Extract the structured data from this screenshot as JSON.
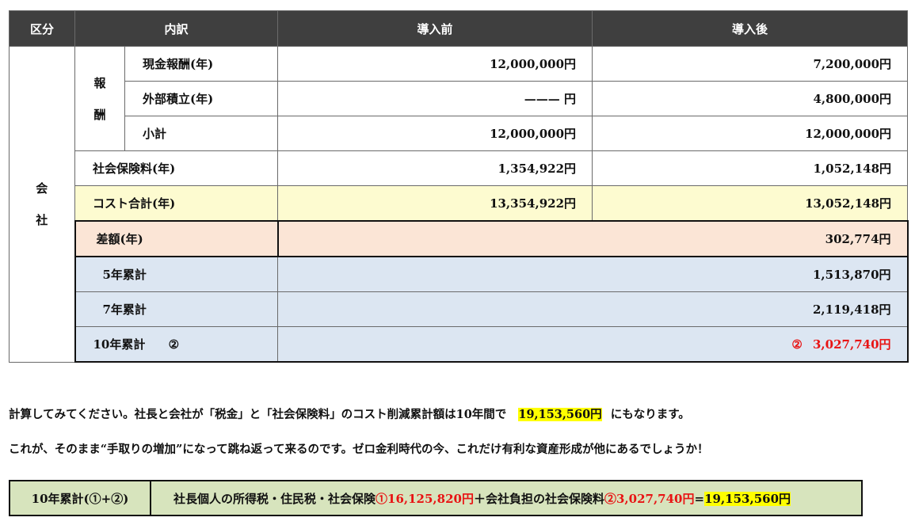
{
  "table": {
    "headers": [
      "区分",
      "内訳",
      "導入前",
      "導入後"
    ],
    "category_company": [
      "会",
      "社"
    ],
    "category_pay": [
      "報",
      "酬"
    ],
    "rows": {
      "cash": {
        "label": "現金報酬(年)",
        "before": "12,000,000円",
        "after": "7,200,000円"
      },
      "external": {
        "label": "外部積立(年)",
        "before": "——— 円",
        "after": "4,800,000円"
      },
      "subtotal": {
        "label": "小計",
        "before": "12,000,000円",
        "after": "12,000,000円"
      },
      "social": {
        "label": "社会保険料(年)",
        "before": "1,354,922円",
        "after": "1,052,148円"
      },
      "cost_total": {
        "label": "コスト合計(年)",
        "before": "13,354,922円",
        "after": "13,052,148円"
      },
      "difference": {
        "label": "差額(年)",
        "value": "302,774円"
      },
      "cum5": {
        "label": "5年累計",
        "value": "1,513,870円"
      },
      "cum7": {
        "label": "7年累計",
        "value": "2,119,418円"
      },
      "cum10": {
        "label": "10年累計",
        "marker": "②",
        "value_marker": "②",
        "value": "3,027,740円"
      }
    }
  },
  "text": {
    "line1_a": "計算してみてください。社長と会社が「税金」と「社会保険料」のコスト削減累計額は10年間で",
    "line1_amount": "19,153,560円",
    "line1_b": "にもなります。",
    "line2": "これが、そのまま“手取りの増加”になって跳ね返って来るのです。ゼロ金利時代の今、これだけ有利な資産形成が他にあるでしょうか！"
  },
  "summary": {
    "label": "10年累計(①+②)",
    "prefix": "社長個人の所得税・住民税・社会保険",
    "part1": "①16,125,820円",
    "middle": "＋会社負担の社会保険料",
    "part2": "②3,027,740円",
    "equals": "=",
    "total": "19,153,560円"
  },
  "colors": {
    "header_bg": "#3f3f3f",
    "cost_total_bg": "#fdfbd0",
    "difference_bg": "#fbe5d6",
    "cumulative_bg": "#dce6f2",
    "summary_bg": "#d7e4bd",
    "highlight": "#ffff00",
    "accent_red": "#e81313"
  }
}
